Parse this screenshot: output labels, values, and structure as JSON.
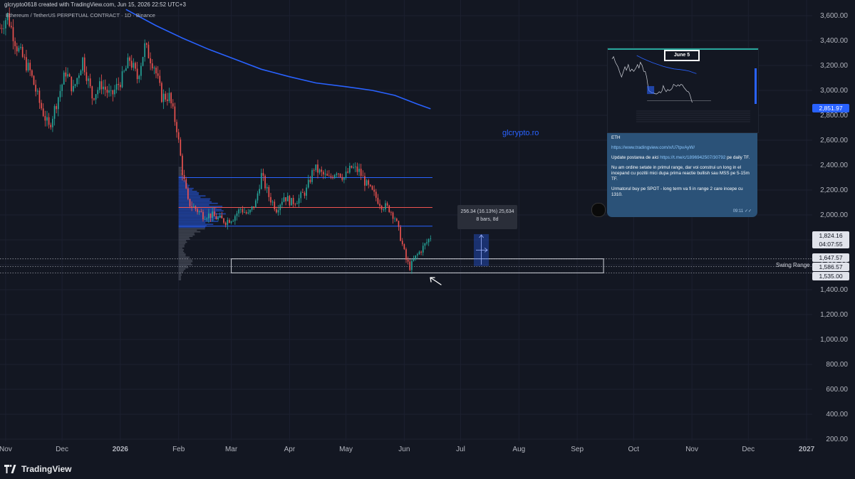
{
  "header": {
    "created_by": "glcrypto0618 created with TradingView.com, Jun 15, 2026 22:52 UTC+3",
    "symbol": "Ethereum / TetherUS PERPETUAL CONTRACT · 1D · Binance"
  },
  "watermark": "glcrypto.ro",
  "brand": "TradingView",
  "colors": {
    "background": "#131722",
    "up_candle": "#26a69a",
    "down_candle": "#ef5350",
    "moving_average": "#2962ff",
    "level_blue": "#2962ff",
    "level_red": "#ef5350",
    "price_tag": "#2962ff"
  },
  "measure_tool": {
    "line1": "256.34 (16.13%) 25,634",
    "line2": "8 bars, 8d"
  },
  "price_labels": {
    "ma_value": "2,851.97",
    "last_price": "1,824.16",
    "countdown": "04:07:55",
    "swing_high": "1,647.57",
    "swing_mid": "1,586.57",
    "swing_low": "1,535.00"
  },
  "swing_range_label": "Swing Range",
  "message": {
    "date_box": "June 5",
    "title": "ETH",
    "link1": "https://www.tradingview.com/x/U7tpvAyW/",
    "update_prefix": "Update postarea de aici ",
    "link2": "https://t.me/c/1896942507/30792",
    "update_suffix": " pe daily TF.",
    "para2": "Nu am ordine setate in primul range, dar voi construi un long in el incepand cu pozitii mici dupa prima reactie bullish sau MSS pe 5-15m TF.",
    "para3": "Urmatorul buy pe SPOT - long term va fi in range 2 care incepe cu 1310.",
    "time": "09:11"
  },
  "chart_data": {
    "type": "candlestick",
    "title": "Ethereum / TetherUS PERPETUAL CONTRACT · 1D · Binance",
    "ylim": [
      150,
      3650
    ],
    "y_ticks": [
      "3,600.00",
      "3,400.00",
      "3,200.00",
      "3,000.00",
      "2,800.00",
      "2,600.00",
      "2,400.00",
      "2,200.00",
      "2,000.00",
      "1,800.00",
      "1,600.00",
      "1,400.00",
      "1,200.00",
      "1,000.00",
      "800.00",
      "600.00",
      "400.00",
      "200.00"
    ],
    "y_tick_values": [
      3600,
      3400,
      3200,
      3000,
      2800,
      2600,
      2400,
      2200,
      2000,
      1800,
      1600,
      1400,
      1200,
      1000,
      800,
      600,
      400,
      200
    ],
    "x_ticks": [
      "Nov",
      "Dec",
      "2026",
      "Feb",
      "Mar",
      "Apr",
      "May",
      "Jun",
      "Jul",
      "Aug",
      "Sep",
      "Oct",
      "Nov",
      "Dec",
      "2027"
    ],
    "x_tick_dates": [
      "2025-11-01",
      "2025-12-01",
      "2026-01-01",
      "2026-02-01",
      "2026-03-01",
      "2026-04-01",
      "2026-05-01",
      "2026-06-01",
      "2026-07-01",
      "2026-08-01",
      "2026-09-01",
      "2026-10-01",
      "2026-11-01",
      "2026-12-01",
      "2027-01-01"
    ],
    "x_range": [
      "2025-10-29",
      "2027-01-04"
    ],
    "price_path": [
      [
        "2025-10-29",
        3500
      ],
      [
        "2025-11-02",
        3600
      ],
      [
        "2025-11-07",
        3350
      ],
      [
        "2025-11-14",
        3150
      ],
      [
        "2025-11-19",
        2900
      ],
      [
        "2025-11-24",
        2700
      ],
      [
        "2025-11-28",
        2900
      ],
      [
        "2025-12-03",
        3150
      ],
      [
        "2025-12-07",
        3000
      ],
      [
        "2025-12-12",
        3250
      ],
      [
        "2025-12-17",
        2950
      ],
      [
        "2025-12-22",
        3050
      ],
      [
        "2025-12-27",
        2950
      ],
      [
        "2026-01-02",
        3100
      ],
      [
        "2026-01-06",
        3250
      ],
      [
        "2026-01-10",
        3100
      ],
      [
        "2026-01-14",
        3350
      ],
      [
        "2026-01-19",
        3200
      ],
      [
        "2026-01-23",
        2950
      ],
      [
        "2026-01-27",
        2950
      ],
      [
        "2026-01-31",
        2700
      ],
      [
        "2026-02-03",
        2350
      ],
      [
        "2026-02-06",
        2100
      ],
      [
        "2026-02-10",
        2050
      ],
      [
        "2026-02-14",
        2000
      ],
      [
        "2026-02-18",
        2000
      ],
      [
        "2026-02-22",
        1970
      ],
      [
        "2026-02-26",
        1950
      ],
      [
        "2026-03-02",
        1980
      ],
      [
        "2026-03-06",
        2050
      ],
      [
        "2026-03-10",
        2000
      ],
      [
        "2026-03-14",
        2100
      ],
      [
        "2026-03-17",
        2320
      ],
      [
        "2026-03-21",
        2150
      ],
      [
        "2026-03-25",
        2050
      ],
      [
        "2026-03-29",
        2150
      ],
      [
        "2026-04-02",
        2100
      ],
      [
        "2026-04-06",
        2130
      ],
      [
        "2026-04-10",
        2200
      ],
      [
        "2026-04-14",
        2380
      ],
      [
        "2026-04-18",
        2330
      ],
      [
        "2026-04-22",
        2290
      ],
      [
        "2026-04-26",
        2360
      ],
      [
        "2026-04-30",
        2300
      ],
      [
        "2026-05-04",
        2380
      ],
      [
        "2026-05-08",
        2350
      ],
      [
        "2026-05-12",
        2240
      ],
      [
        "2026-05-16",
        2160
      ],
      [
        "2026-05-20",
        2080
      ],
      [
        "2026-05-24",
        2050
      ],
      [
        "2026-05-27",
        1980
      ],
      [
        "2026-05-30",
        1820
      ],
      [
        "2026-06-02",
        1640
      ],
      [
        "2026-06-04",
        1580
      ],
      [
        "2026-06-07",
        1660
      ],
      [
        "2026-06-10",
        1720
      ],
      [
        "2026-06-13",
        1780
      ],
      [
        "2026-06-15",
        1824
      ]
    ],
    "moving_average_path": [
      [
        "2026-01-04",
        3650
      ],
      [
        "2026-01-20",
        3520
      ],
      [
        "2026-02-03",
        3420
      ],
      [
        "2026-02-17",
        3330
      ],
      [
        "2026-03-03",
        3250
      ],
      [
        "2026-03-17",
        3170
      ],
      [
        "2026-04-01",
        3110
      ],
      [
        "2026-04-15",
        3060
      ],
      [
        "2026-05-01",
        3030
      ],
      [
        "2026-05-15",
        3000
      ],
      [
        "2026-05-27",
        2960
      ],
      [
        "2026-06-08",
        2890
      ],
      [
        "2026-06-15",
        2852
      ]
    ],
    "horizontal_levels": [
      {
        "price": 2300,
        "color": "#2962ff",
        "from": "2026-02-01",
        "to": "2026-06-16"
      },
      {
        "price": 2060,
        "color": "#ef5350",
        "from": "2026-02-01",
        "to": "2026-06-16"
      },
      {
        "price": 1910,
        "color": "#2962ff",
        "from": "2026-02-01",
        "to": "2026-06-16"
      }
    ],
    "swing_range": {
      "label": "Swing Range",
      "high": 1647.57,
      "mid": 1586.57,
      "low": 1535.0,
      "box_from": "2026-03-01",
      "box_to": "2026-09-15"
    },
    "measure": {
      "from_date": "2026-07-08",
      "to_date": "2026-07-16",
      "low": 1590,
      "high": 1846,
      "change": 256.34,
      "percent": 16.13,
      "ticks": 25634,
      "bars": 8
    },
    "last_price": 1824.16,
    "ma_value": 2851.97
  }
}
